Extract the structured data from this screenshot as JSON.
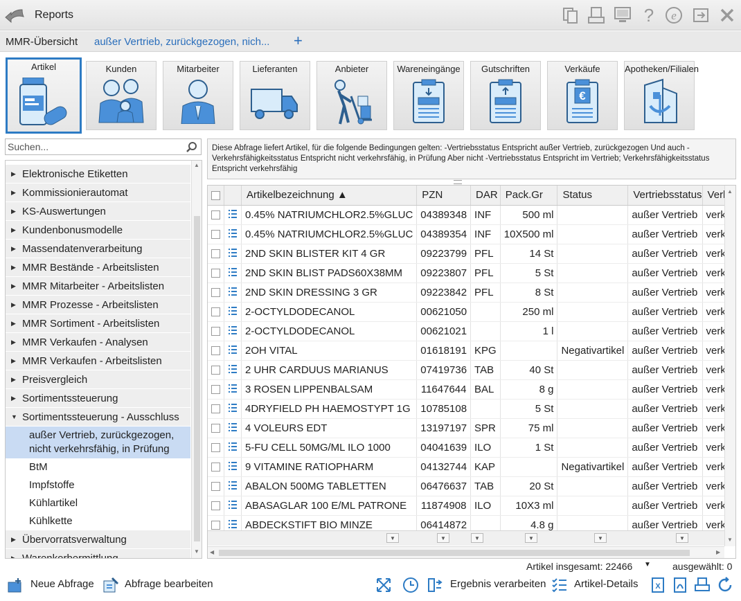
{
  "titlebar": {
    "title": "Reports",
    "icons": [
      "back-icon",
      "copy-icon",
      "print-preview-icon",
      "monitor-icon",
      "help-icon",
      "info-icon",
      "export-icon",
      "close-icon"
    ]
  },
  "tabs": {
    "main": "MMR-Übersicht",
    "query": "außer Vertrieb, zurückgezogen, nich...",
    "add": "+"
  },
  "categories": [
    {
      "label": "Artikel",
      "icon": "medicine-icon",
      "active": true
    },
    {
      "label": "Kunden",
      "icon": "family-icon"
    },
    {
      "label": "Mitarbeiter",
      "icon": "pharmacist-icon"
    },
    {
      "label": "Lieferanten",
      "icon": "truck-icon"
    },
    {
      "label": "Anbieter",
      "icon": "hand-truck-icon"
    },
    {
      "label": "Wareneingänge",
      "icon": "clipboard-in-icon"
    },
    {
      "label": "Gutschriften",
      "icon": "clipboard-out-icon"
    },
    {
      "label": "Verkäufe",
      "icon": "clipboard-euro-icon"
    },
    {
      "label": "Apotheken/Filialen",
      "icon": "pharmacy-icon"
    }
  ],
  "search": {
    "placeholder": "Suchen..."
  },
  "tree": {
    "items": [
      "Elektronische Etiketten",
      "Kommissionierautomat",
      "KS-Auswertungen",
      "Kundenbonusmodelle",
      "Massendatenverarbeitung",
      "MMR Bestände - Arbeitslisten",
      "MMR Mitarbeiter - Arbeitslisten",
      "MMR Prozesse - Arbeitslisten",
      "MMR Sortiment - Arbeitslisten",
      "MMR Verkaufen - Analysen",
      "MMR Verkaufen - Arbeitslisten",
      "Preisvergleich",
      "Sortimentssteuerung"
    ],
    "expanded": "Sortimentssteuerung - Ausschluss",
    "children": [
      "außer Vertrieb, zurückgezogen, nicht verkehrsfähig, in Prüfung",
      "BtM",
      "Impfstoffe",
      "Kühlartikel",
      "Kühlkette"
    ],
    "after": [
      "Übervorratsverwaltung",
      "Warenkorbermittlung"
    ]
  },
  "description": "Diese Abfrage liefert Artikel, für die folgende Bedingungen gelten: -Vertriebsstatus Entspricht außer Vertrieb, zurückgezogen Und auch - Verkehrsfähigkeitsstatus Entspricht nicht verkehrsfähig, in Prüfung Aber nicht -Vertriebsstatus Entspricht im Vertrieb; Verkehrsfähigkeitsstatus Entspricht verkehrsfähig",
  "grid": {
    "columns": [
      "",
      "",
      "Artikelbezeichnung ▲",
      "PZN",
      "DAR",
      "Pack.Gr",
      "Status",
      "Vertriebsstatus",
      "Verk.fä"
    ],
    "rows": [
      [
        "0.45% NATRIUMCHLOR2.5%GLUC",
        "04389348",
        "INF",
        "500 ml",
        "",
        "außer Vertrieb",
        "verkeh"
      ],
      [
        "0.45% NATRIUMCHLOR2.5%GLUC",
        "04389354",
        "INF",
        "10X500 ml",
        "",
        "außer Vertrieb",
        "verkeh"
      ],
      [
        "2ND SKIN BLISTER KIT 4 GR",
        "09223799",
        "PFL",
        "14 St",
        "",
        "außer Vertrieb",
        "verkeh"
      ],
      [
        "2ND SKIN BLIST PADS60X38MM",
        "09223807",
        "PFL",
        "5 St",
        "",
        "außer Vertrieb",
        "verkeh"
      ],
      [
        "2ND SKIN DRESSING 3 GR",
        "09223842",
        "PFL",
        "8 St",
        "",
        "außer Vertrieb",
        "verkeh"
      ],
      [
        "2-OCTYLDODECANOL",
        "00621050",
        "",
        "250 ml",
        "",
        "außer Vertrieb",
        "verkeh"
      ],
      [
        "2-OCTYLDODECANOL",
        "00621021",
        "",
        "1 l",
        "",
        "außer Vertrieb",
        "verkeh"
      ],
      [
        "2OH VITAL",
        "01618191",
        "KPG",
        "",
        "Negativartikel",
        "außer Vertrieb",
        "verkeh"
      ],
      [
        "2 UHR CARDUUS MARIANUS",
        "07419736",
        "TAB",
        "40 St",
        "",
        "außer Vertrieb",
        "verkeh"
      ],
      [
        "3 ROSEN LIPPENBALSAM",
        "11647644",
        "BAL",
        "8 g",
        "",
        "außer Vertrieb",
        "verkeh"
      ],
      [
        "4DRYFIELD PH HAEMOSTYPT 1G",
        "10785108",
        "",
        "5 St",
        "",
        "außer Vertrieb",
        "verkeh"
      ],
      [
        "4 VOLEURS EDT",
        "13197197",
        "SPR",
        "75 ml",
        "",
        "außer Vertrieb",
        "verkeh"
      ],
      [
        "5-FU CELL 50MG/ML ILO 1000",
        "04041639",
        "ILO",
        "1 St",
        "",
        "außer Vertrieb",
        "verkeh"
      ],
      [
        "9 VITAMINE RATIOPHARM",
        "04132744",
        "KAP",
        "",
        "Negativartikel",
        "außer Vertrieb",
        "verkeh"
      ],
      [
        "ABALON 500MG TABLETTEN",
        "06476637",
        "TAB",
        "20 St",
        "",
        "außer Vertrieb",
        "verkeh"
      ],
      [
        "ABASAGLAR 100 E/ML PATRONE",
        "11874908",
        "ILO",
        "10X3 ml",
        "",
        "außer Vertrieb",
        "verkeh"
      ],
      [
        "ABDECKSTIFT BIO MINZE",
        "06414872",
        "",
        "4.8 g",
        "",
        "außer Vertrieb",
        "verkeh"
      ]
    ]
  },
  "footer": {
    "total": "Artikel insgesamt: 22466",
    "selected": "ausgewählt: 0"
  },
  "bottombar": {
    "new_query": "Neue Abfrage",
    "edit_query": "Abfrage bearbeiten",
    "process_result": "Ergebnis verarbeiten",
    "article_details": "Artikel-Details"
  },
  "colors": {
    "accent": "#2d7bc4",
    "link": "#2a6ebb",
    "selection": "#c9dbf3"
  }
}
